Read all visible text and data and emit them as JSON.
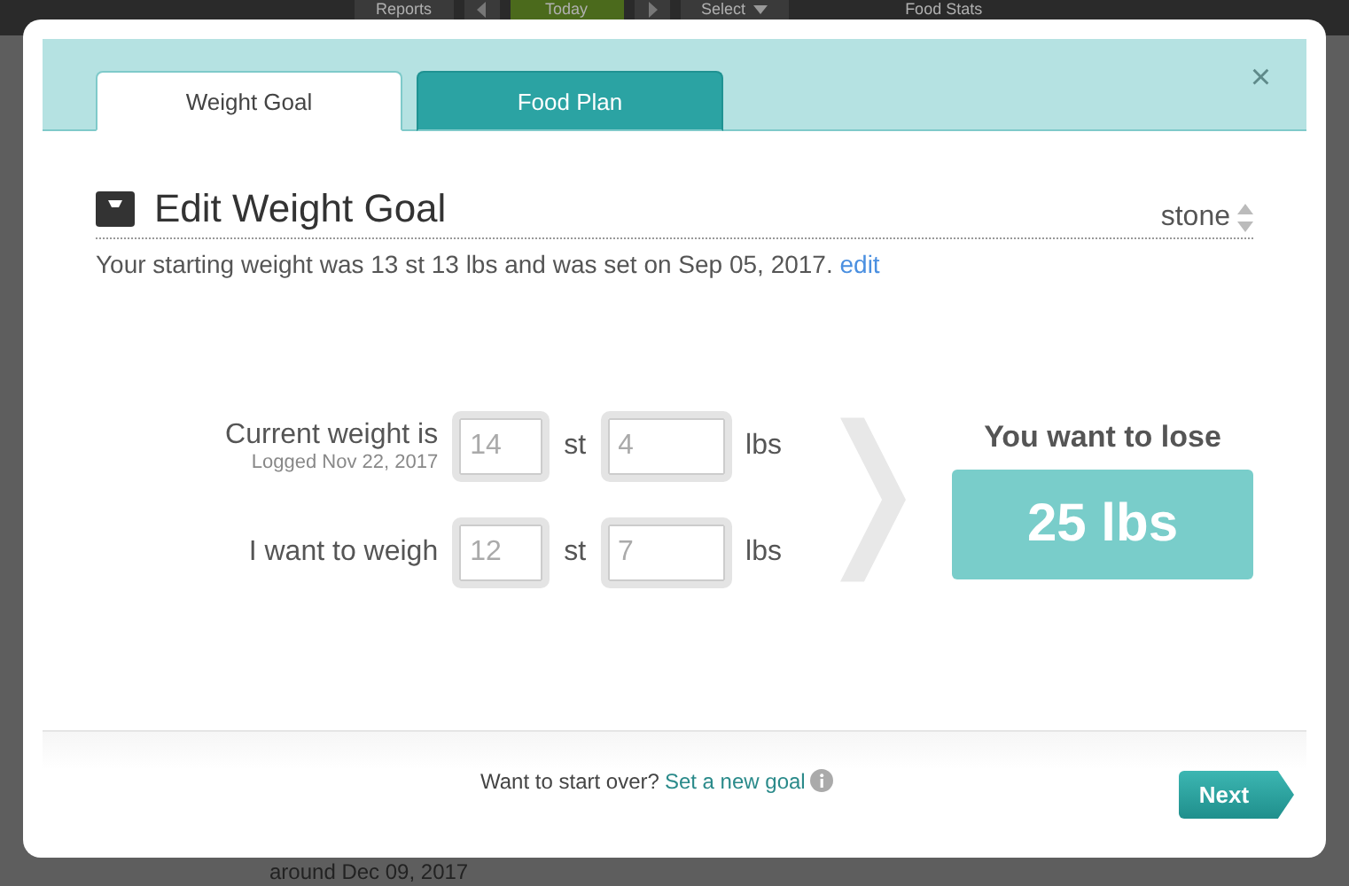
{
  "background": {
    "top_bar": {
      "reports_button": "Reports",
      "today_button": "Today",
      "select_button": "Select",
      "side_title": "Food Stats"
    },
    "bottom_text": "around Dec 09, 2017"
  },
  "modal": {
    "tabs": [
      {
        "label": "Weight Goal",
        "selected": true
      },
      {
        "label": "Food Plan",
        "selected": false
      }
    ],
    "close": "×",
    "title": "Edit Weight Goal",
    "unit_select": "stone",
    "intro": "Your starting weight was 13 st 13 lbs and was set on Sep 05, 2017.",
    "intro_link": "edit",
    "rows": [
      {
        "label": "Current weight is",
        "note": "Logged Nov 22, 2017",
        "stones": {
          "placeholder": "14"
        },
        "stone_unit": "st",
        "pounds": {
          "placeholder": "4"
        },
        "pound_unit": "lbs"
      },
      {
        "label": "I want to weigh",
        "stones": {
          "placeholder": "12"
        },
        "stone_unit": "st",
        "pounds": {
          "placeholder": "7"
        },
        "pound_unit": "lbs"
      }
    ],
    "result_label": "You want to lose",
    "result_value": "25 lbs",
    "footer_text": "Want to start over?",
    "footer_link": "Set a new goal",
    "next_button": "Next"
  }
}
